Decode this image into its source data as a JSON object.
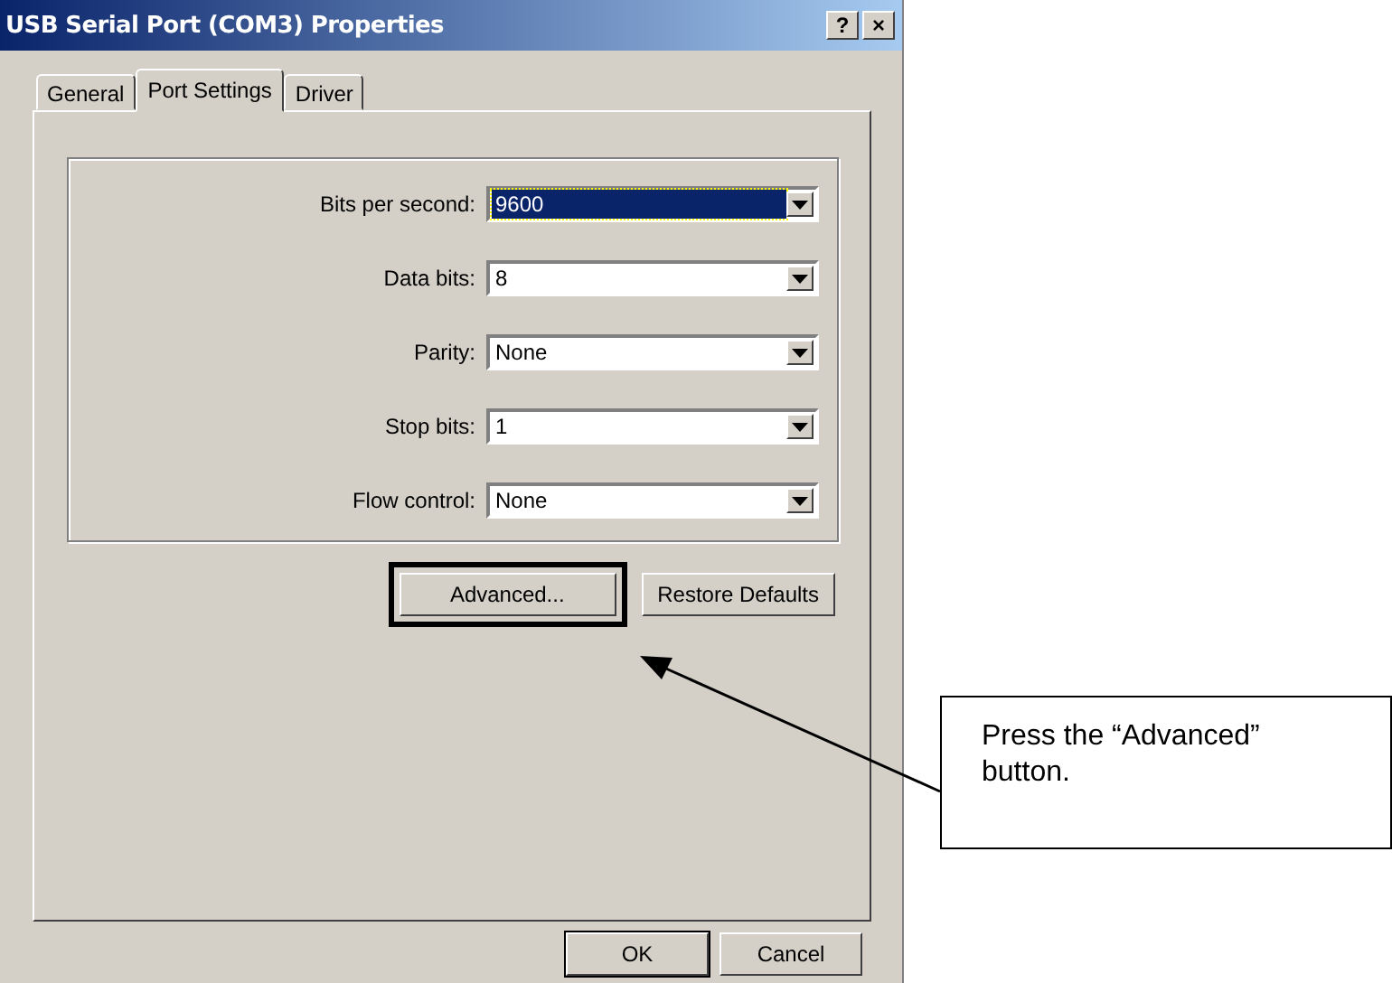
{
  "window": {
    "title": "USB Serial Port (COM3) Properties",
    "title_buttons": [
      "?",
      "×"
    ]
  },
  "tabs": [
    {
      "label": "General",
      "selected": false
    },
    {
      "label": "Port Settings",
      "selected": true
    },
    {
      "label": "Driver",
      "selected": false
    }
  ],
  "settings": [
    {
      "label": "Bits per second:",
      "value": "9600",
      "focused": true
    },
    {
      "label": "Data bits:",
      "value": "8",
      "focused": false
    },
    {
      "label": "Parity:",
      "value": "None",
      "focused": false
    },
    {
      "label": "Stop bits:",
      "value": "1",
      "focused": false
    },
    {
      "label": "Flow control:",
      "value": "None",
      "focused": false
    }
  ],
  "port_buttons": [
    {
      "label": "Advanced...",
      "highlighted": true
    },
    {
      "label": "Restore Defaults",
      "highlighted": false
    }
  ],
  "dialog_buttons": [
    {
      "label": "OK",
      "default": true
    },
    {
      "label": "Cancel",
      "default": false
    }
  ],
  "callout": {
    "text": "Press the “Advanced” button."
  }
}
